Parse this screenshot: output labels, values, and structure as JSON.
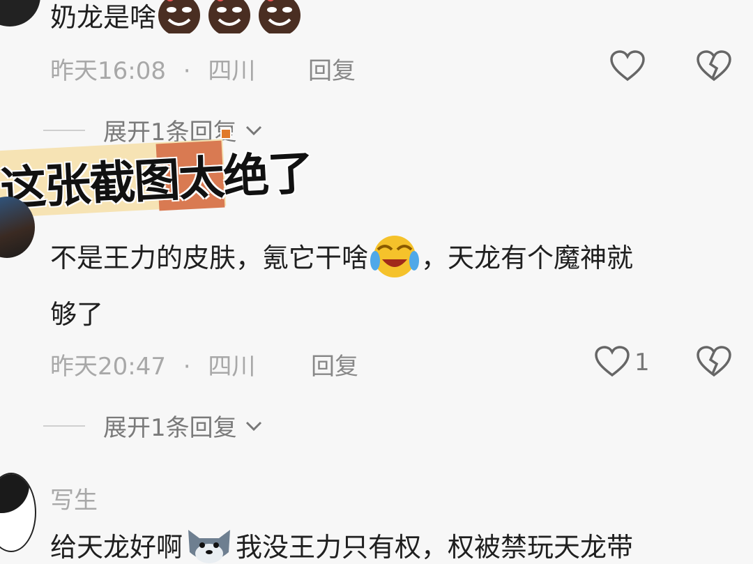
{
  "comments": [
    {
      "text": "奶龙是啥",
      "time": "昨天16:08",
      "location": "四川",
      "reply_label": "回复",
      "like_count": "",
      "expand_label": "展开1条回复"
    },
    {
      "text_part1": "不是王力的皮肤，氪它干啥",
      "text_part2": "，天龙有个魔神就",
      "text_line2": "够了",
      "time": "昨天20:47",
      "location": "四川",
      "reply_label": "回复",
      "like_count": "1",
      "expand_label": "展开1条回复"
    },
    {
      "username": "写生",
      "text_part1": "给天龙好啊",
      "text_part2": "我没王力只有权，权被禁玩天龙带"
    }
  ],
  "separator": "·",
  "banner": {
    "text": "这张截图太绝了",
    "bg_color": "#f6e3b4",
    "highlight_color": "#d97a52"
  },
  "icons": {
    "like": "heart-outline-icon",
    "dislike": "broken-heart-icon",
    "expand": "chevron-down-icon"
  }
}
